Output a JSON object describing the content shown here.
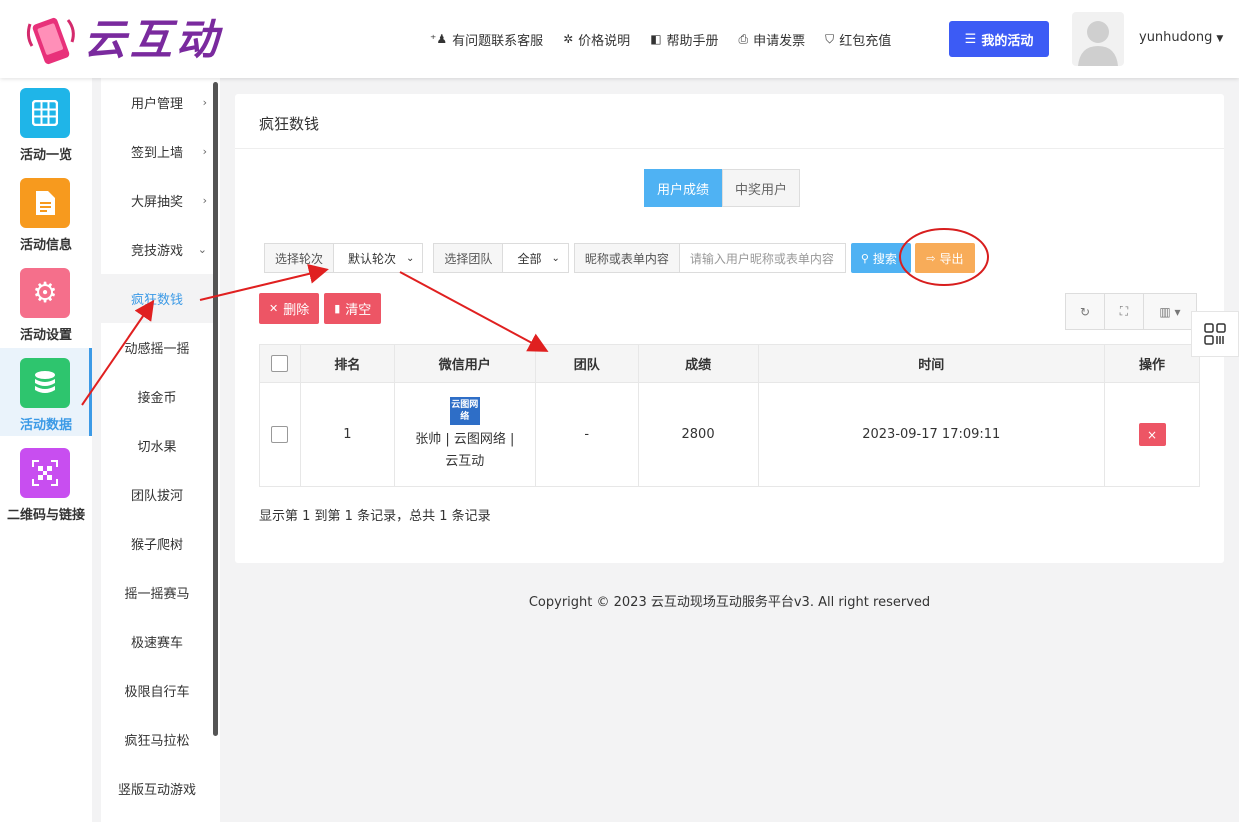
{
  "brand": {
    "name": "云互动"
  },
  "topnav": [
    {
      "icon": "person-plus-icon",
      "glyph": "⁺👤",
      "label": "有问题联系客服"
    },
    {
      "icon": "gear-badge-icon",
      "glyph": "✲",
      "label": "价格说明"
    },
    {
      "icon": "book-icon",
      "glyph": "◧",
      "label": "帮助手册"
    },
    {
      "icon": "printer-icon",
      "glyph": "⎙",
      "label": "申请发票"
    },
    {
      "icon": "shield-check-icon",
      "glyph": "⛉",
      "label": "红包充值"
    }
  ],
  "my_activity": {
    "label": "我的活动",
    "glyph": "☰"
  },
  "user": {
    "name": "yunhudong"
  },
  "icon_sidebar": [
    {
      "label": "活动一览",
      "color": "#1fb5e8",
      "icon": "grid-icon"
    },
    {
      "label": "活动信息",
      "color": "#f79a1e",
      "icon": "document-icon"
    },
    {
      "label": "活动设置",
      "color": "#f56f8b",
      "icon": "gear-icon"
    },
    {
      "label": "活动数据",
      "color": "#2ec56e",
      "icon": "database-icon"
    },
    {
      "label": "二维码与链接",
      "color": "#c84ef0",
      "icon": "qrcode-icon"
    }
  ],
  "sub_menu": [
    {
      "label": "用户管理",
      "arrow": "›"
    },
    {
      "label": "签到上墙",
      "arrow": "›"
    },
    {
      "label": "大屏抽奖",
      "arrow": "›"
    },
    {
      "label": "竞技游戏",
      "arrow": "⌄"
    },
    {
      "label": "疯狂数钱",
      "arrow": ""
    },
    {
      "label": "动感摇一摇",
      "arrow": ""
    },
    {
      "label": "接金币",
      "arrow": ""
    },
    {
      "label": "切水果",
      "arrow": ""
    },
    {
      "label": "团队拔河",
      "arrow": ""
    },
    {
      "label": "猴子爬树",
      "arrow": ""
    },
    {
      "label": "摇一摇赛马",
      "arrow": ""
    },
    {
      "label": "极速赛车",
      "arrow": ""
    },
    {
      "label": "极限自行车",
      "arrow": ""
    },
    {
      "label": "疯狂马拉松",
      "arrow": ""
    },
    {
      "label": "竖版互动游戏",
      "arrow": ""
    }
  ],
  "card": {
    "title": "疯狂数钱"
  },
  "tabs": [
    {
      "label": "用户成绩"
    },
    {
      "label": "中奖用户"
    }
  ],
  "filters": {
    "round_label": "选择轮次",
    "round_value": "默认轮次",
    "team_label": "选择团队",
    "team_value": "全部",
    "keyword_label": "昵称或表单内容",
    "keyword_placeholder": "请输入用户昵称或表单内容",
    "search_label": "搜索",
    "export_label": "导出"
  },
  "actions": {
    "delete_label": "删除",
    "clear_label": "清空"
  },
  "table": {
    "columns": [
      "排名",
      "微信用户",
      "团队",
      "成绩",
      "时间",
      "操作"
    ],
    "rows": [
      {
        "rank": "1",
        "avatar_text": "云图网络",
        "user": "张帅 | 云图网络 | 云互动",
        "team": "-",
        "score": "2800",
        "time": "2023-09-17 17:09:11",
        "op": "×"
      }
    ]
  },
  "pager_info": "显示第 1 到第 1 条记录，总共 1 条记录",
  "copyright": "Copyright © 2023 云互动现场互动服务平台v3. All right reserved"
}
